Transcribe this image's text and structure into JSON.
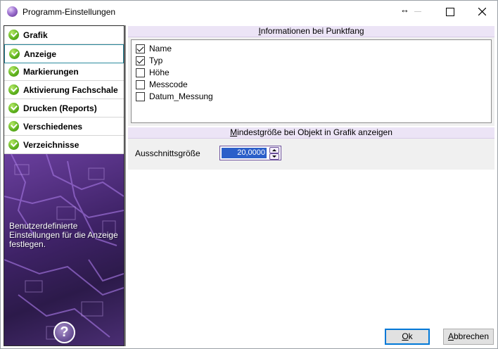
{
  "window": {
    "title": "Programm-Einstellungen",
    "icons": {
      "app": "purple-orb-icon",
      "resize": "horizontal-resize-icon",
      "minimize": "minimize-icon",
      "maximize": "maximize-icon",
      "close": "close-icon"
    },
    "resize_glyph": "↔"
  },
  "sidebar": {
    "items": [
      {
        "label": "Grafik",
        "active": false
      },
      {
        "label": "Anzeige",
        "active": true
      },
      {
        "label": "Markierungen",
        "active": false
      },
      {
        "label": "Aktivierung Fachschale",
        "active": false
      },
      {
        "label": "Drucken (Reports)",
        "active": false
      },
      {
        "label": "Verschiedenes",
        "active": false
      },
      {
        "label": "Verzeichnisse",
        "active": false
      }
    ],
    "description": "Benutzerdefinierte Einstellungen für die Anzeige festlegen.",
    "help_label": "?"
  },
  "punktfang": {
    "header_prefix": "I",
    "header_rest": "nformationen bei Punktfang",
    "options": [
      {
        "label": "Name",
        "checked": true
      },
      {
        "label": "Typ",
        "checked": true
      },
      {
        "label": "Höhe",
        "checked": false
      },
      {
        "label": "Messcode",
        "checked": false
      },
      {
        "label": "Datum_Messung",
        "checked": false
      }
    ]
  },
  "mindestgroesse": {
    "header_prefix": "M",
    "header_rest": "indestgröße bei Objekt in Grafik anzeigen",
    "field_label": "Ausschnittsgröße",
    "value": "20,0000"
  },
  "buttons": {
    "ok_prefix": "O",
    "ok_rest": "k",
    "cancel_prefix": "A",
    "cancel_rest": "bbrechen"
  },
  "colors": {
    "accent_purple": "#ece4f6",
    "nav_active_border": "#2b8a9e",
    "check_green": "#62b51f",
    "selection_blue": "#2b5fc9"
  }
}
